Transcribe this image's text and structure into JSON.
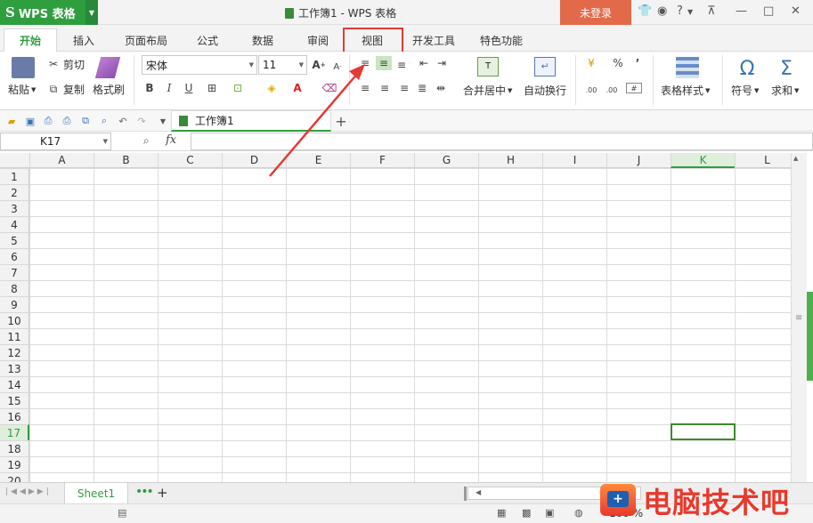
{
  "titlebar": {
    "app_name": "WPS 表格",
    "app_logo": "S",
    "doc_title": "工作簿1 - WPS 表格",
    "login_label": "未登录",
    "help_label": "?"
  },
  "tabs": [
    "开始",
    "插入",
    "页面布局",
    "公式",
    "数据",
    "审阅",
    "视图",
    "开发工具",
    "特色功能"
  ],
  "active_tab": "开始",
  "highlighted_tab": "视图",
  "ribbon": {
    "paste": "粘贴",
    "cut": "剪切",
    "copy": "复制",
    "format_painter": "格式刷",
    "font_name": "宋体",
    "font_size": "11",
    "bold": "B",
    "italic": "I",
    "underline": "U",
    "merge_center": "合并居中",
    "wrap_text": "自动换行",
    "percent": "%",
    "comma": "’",
    "table_style": "表格样式",
    "symbol": "符号",
    "symbol_glyph": "Ω",
    "sum": "求和",
    "sum_glyph": "Σ"
  },
  "workbook_tab": "工作簿1",
  "add_tab": "+",
  "formula_bar": {
    "name_box": "K17",
    "fx_label": "fx",
    "formula": ""
  },
  "columns": [
    "A",
    "B",
    "C",
    "D",
    "E",
    "F",
    "G",
    "H",
    "I",
    "J",
    "K",
    "L"
  ],
  "selected_column": "K",
  "rows": [
    "1",
    "2",
    "3",
    "4",
    "5",
    "6",
    "7",
    "8",
    "9",
    "10",
    "11",
    "12",
    "13",
    "14",
    "15",
    "16",
    "17",
    "18",
    "19",
    "20"
  ],
  "selected_row": "17",
  "sheet_tabs": [
    "Sheet1"
  ],
  "sheet_add": "+",
  "status": {
    "zoom": "100 %"
  },
  "watermark": "电脑技术吧",
  "colors": {
    "accent_green": "#2f9e3f",
    "login_orange": "#e2694a",
    "highlight_red": "#e53935"
  }
}
